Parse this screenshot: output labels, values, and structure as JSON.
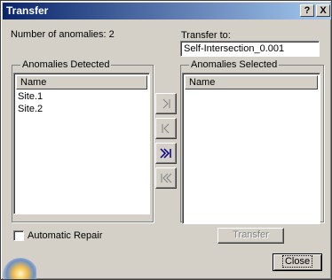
{
  "window": {
    "title": "Transfer",
    "help_label": "?",
    "close_label": "X"
  },
  "anomalies": {
    "label": "Number of anomalies:",
    "count": "2"
  },
  "transfer_to": {
    "label": "Transfer to:",
    "value": "Self-Intersection_0.001"
  },
  "detected": {
    "group_label": "Anomalies Detected",
    "column_header": "Name",
    "items": [
      "Site.1",
      "Site.2"
    ]
  },
  "selected": {
    "group_label": "Anomalies Selected",
    "column_header": "Name",
    "items": []
  },
  "arrow_buttons": {
    "icons": [
      "move-right-icon",
      "move-left-icon",
      "move-all-right-icon",
      "move-all-left-icon"
    ]
  },
  "options": {
    "automatic_repair_label": "Automatic Repair",
    "automatic_repair_checked": false
  },
  "buttons": {
    "transfer_label": "Transfer",
    "close_label": "Close"
  },
  "colors": {
    "title_gradient_start": "#0a246a",
    "title_gradient_end": "#a6caf0",
    "dialog_bg": "#d4d0c8",
    "disabled_text": "#808080"
  }
}
